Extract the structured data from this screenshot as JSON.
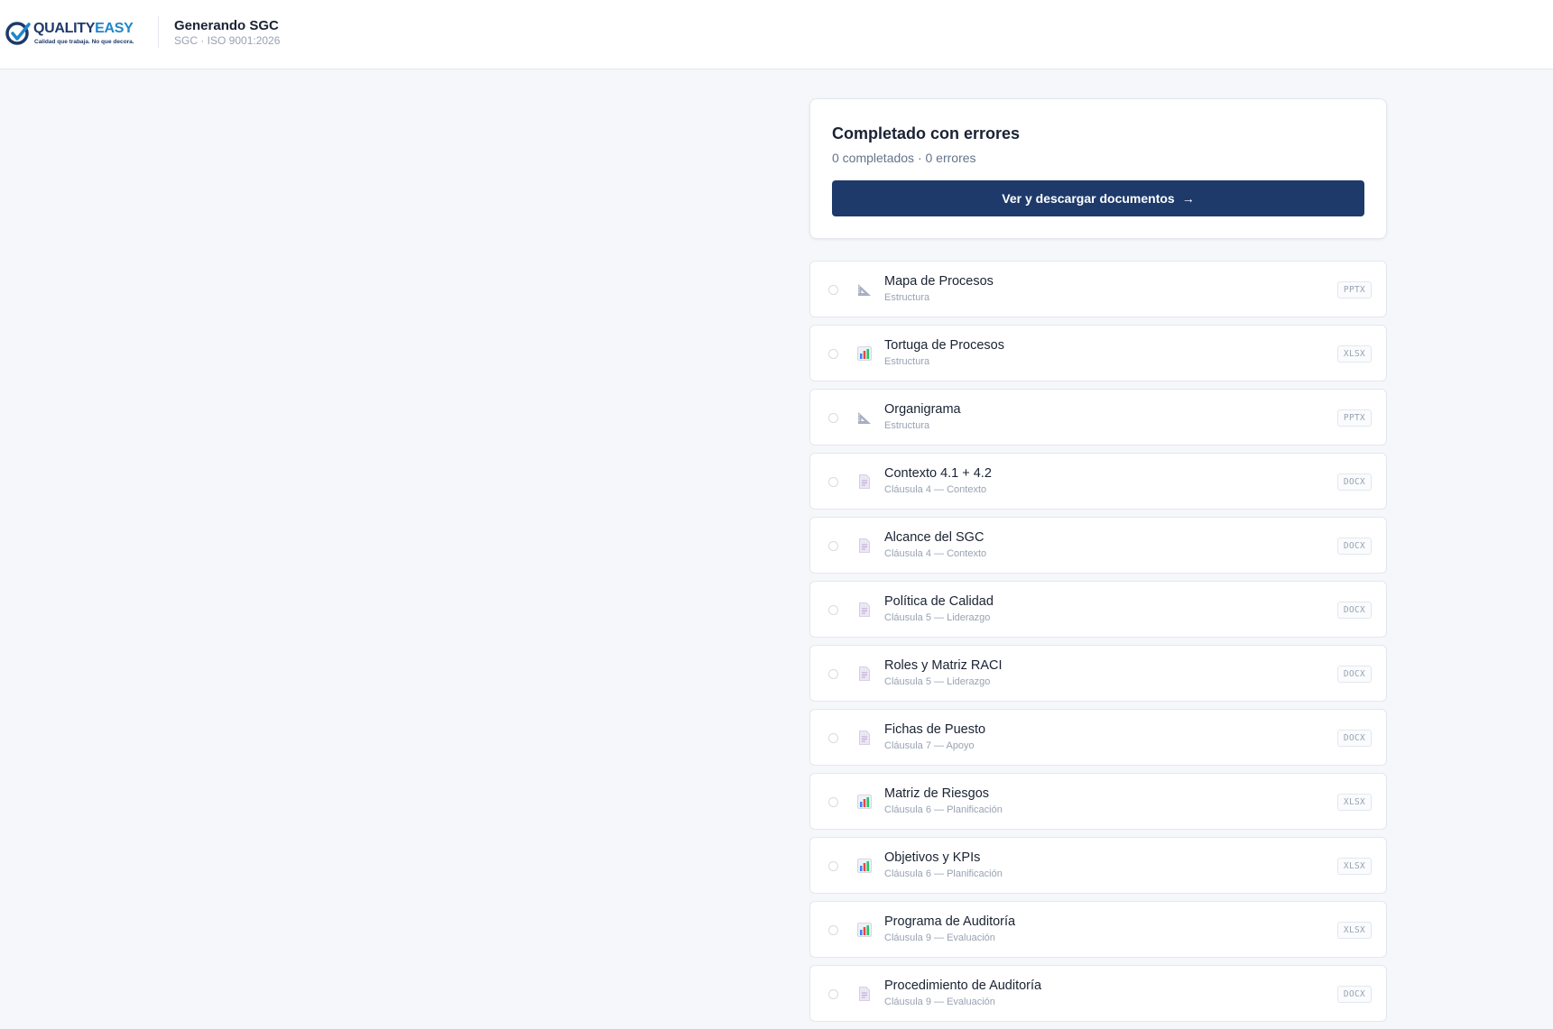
{
  "header": {
    "brand_quality": "QUALITY",
    "brand_easy": "EASY",
    "brand_tagline": "Calidad que trabaja. No que decora.",
    "title": "Generando SGC",
    "subtitle": "SGC · ISO 9001:2026"
  },
  "status": {
    "title": "Completado con errores",
    "counts": "0 completados · 0 errores",
    "button_label": "Ver y descargar documentos"
  },
  "colors": {
    "primary": "#1e3a6b",
    "brand_accent": "#1f86c9",
    "background": "#f5f7fa"
  },
  "documents": [
    {
      "name": "Mapa de Procesos",
      "category": "Estructura",
      "type": "PPTX",
      "icon": "ruler-triangle-icon"
    },
    {
      "name": "Tortuga de Procesos",
      "category": "Estructura",
      "type": "XLSX",
      "icon": "bar-chart-icon"
    },
    {
      "name": "Organigrama",
      "category": "Estructura",
      "type": "PPTX",
      "icon": "ruler-triangle-icon"
    },
    {
      "name": "Contexto 4.1 + 4.2",
      "category": "Cláusula 4 — Contexto",
      "type": "DOCX",
      "icon": "document-icon"
    },
    {
      "name": "Alcance del SGC",
      "category": "Cláusula 4 — Contexto",
      "type": "DOCX",
      "icon": "document-icon"
    },
    {
      "name": "Política de Calidad",
      "category": "Cláusula 5 — Liderazgo",
      "type": "DOCX",
      "icon": "document-icon"
    },
    {
      "name": "Roles y Matriz RACI",
      "category": "Cláusula 5 — Liderazgo",
      "type": "DOCX",
      "icon": "document-icon"
    },
    {
      "name": "Fichas de Puesto",
      "category": "Cláusula 7 — Apoyo",
      "type": "DOCX",
      "icon": "document-icon"
    },
    {
      "name": "Matriz de Riesgos",
      "category": "Cláusula 6 — Planificación",
      "type": "XLSX",
      "icon": "bar-chart-icon"
    },
    {
      "name": "Objetivos y KPIs",
      "category": "Cláusula 6 — Planificación",
      "type": "XLSX",
      "icon": "bar-chart-icon"
    },
    {
      "name": "Programa de Auditoría",
      "category": "Cláusula 9 — Evaluación",
      "type": "XLSX",
      "icon": "bar-chart-icon"
    },
    {
      "name": "Procedimiento de Auditoría",
      "category": "Cláusula 9 — Evaluación",
      "type": "DOCX",
      "icon": "document-icon"
    }
  ]
}
